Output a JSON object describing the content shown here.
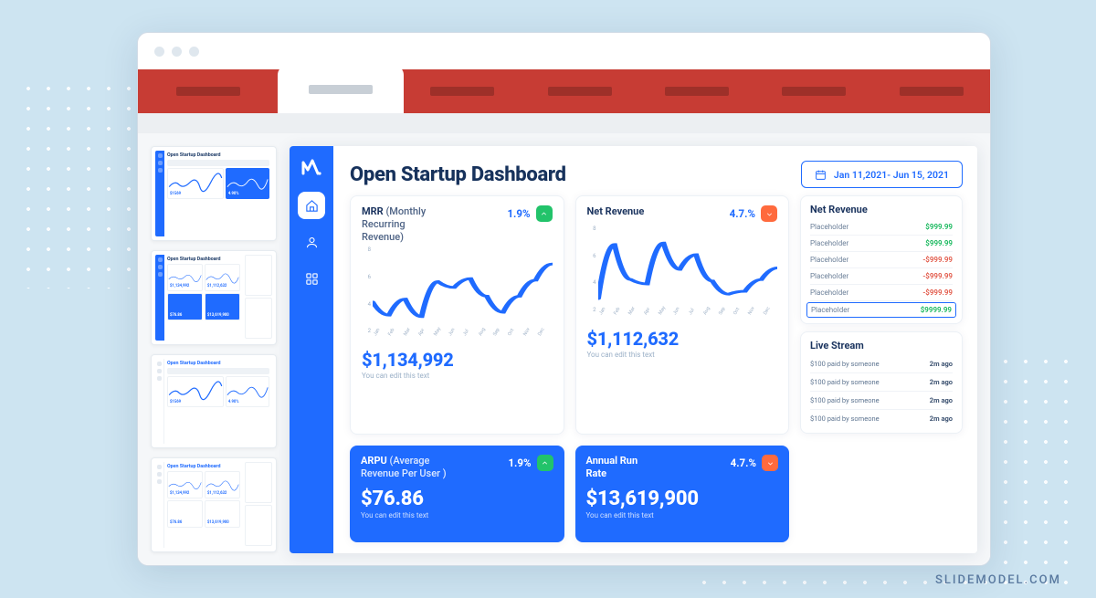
{
  "attribution": "SLIDEMODEL.COM",
  "sidebar": {
    "items": [
      {
        "name": "home",
        "active": true
      },
      {
        "name": "user",
        "active": false
      },
      {
        "name": "apps",
        "active": false
      }
    ]
  },
  "header": {
    "title": "Open Startup Dashboard",
    "date_range": "Jan 11,2021- Jun 15, 2021"
  },
  "cards": {
    "mrr": {
      "label_strong": "MRR",
      "label_light": " (Monthly Recurring Revenue)",
      "pct": "1.9%",
      "trend": "up",
      "value": "$1,134,992",
      "sub": "You can edit this text"
    },
    "net": {
      "label_strong": "Net Revenue",
      "label_light": "",
      "pct": "4.7.%",
      "trend": "down",
      "value": "$1,112,632",
      "sub": "You can edit this text"
    },
    "arpu": {
      "label_strong": "ARPU",
      "label_light": " (Average Revenue Per User )",
      "pct": "1.9%",
      "trend": "up",
      "value": "$76.86",
      "sub": "You can edit this text"
    },
    "arr": {
      "label_strong": "Annual Run Rate",
      "label_light": "",
      "pct": "4.7.%",
      "trend": "down",
      "value": "$13,619,900",
      "sub": "You can edit this text"
    }
  },
  "net_revenue_panel": {
    "title": "Net Revenue",
    "rows": [
      {
        "label": "Placeholder",
        "value": "$999.99",
        "cls": "g",
        "sel": false
      },
      {
        "label": "Placeholder",
        "value": "$999.99",
        "cls": "g",
        "sel": false
      },
      {
        "label": "Placeholder",
        "value": "-$999.99",
        "cls": "r",
        "sel": false
      },
      {
        "label": "Placeholder",
        "value": "-$999.99",
        "cls": "r",
        "sel": false
      },
      {
        "label": "Placeholder",
        "value": "-$999.99",
        "cls": "r",
        "sel": false
      },
      {
        "label": "Placeholder",
        "value": "$9999.99",
        "cls": "g",
        "sel": true
      }
    ]
  },
  "live_stream_panel": {
    "title": "Live Stream",
    "rows": [
      {
        "text": "$100 paid by someone",
        "ago": "2m ago"
      },
      {
        "text": "$100 paid by someone",
        "ago": "2m ago"
      },
      {
        "text": "$100 paid by someone",
        "ago": "2m ago"
      },
      {
        "text": "$100 paid by someone",
        "ago": "2m ago"
      }
    ]
  },
  "thumb_title": "Open Startup Dashboard",
  "thumb_vals": {
    "v1": "$1569",
    "v2": "4.90%",
    "v3": "$1,134,992",
    "v4": "$1,112,632",
    "v5": "$76.86",
    "v6": "$13,619,900"
  },
  "chart_data": {
    "months": [
      "Jan",
      "Feb",
      "Mar",
      "Apr",
      "May",
      "Jun",
      "Jul",
      "Aug",
      "Sep",
      "Oct",
      "Nov",
      "Dec"
    ],
    "yticks": [
      8,
      6,
      4,
      2
    ],
    "mrr": {
      "type": "line",
      "ylim": [
        2,
        8
      ],
      "values": [
        4.2,
        3.3,
        4.4,
        3.2,
        5.6,
        5.2,
        5.8,
        4.6,
        3.5,
        4.6,
        5.7,
        6.8
      ]
    },
    "net": {
      "type": "line",
      "ylim": [
        2,
        8
      ],
      "values": [
        3.0,
        6.7,
        4.3,
        4.0,
        6.8,
        5.0,
        6.0,
        4.2,
        3.3,
        3.5,
        4.3,
        5.1
      ]
    }
  }
}
